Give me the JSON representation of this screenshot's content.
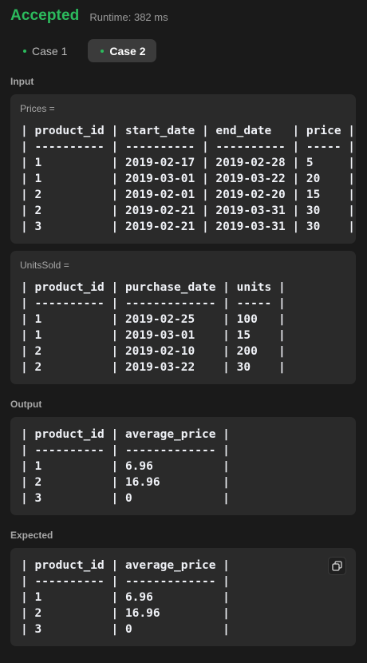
{
  "header": {
    "status": "Accepted",
    "runtime": "Runtime: 382 ms"
  },
  "tabs": [
    {
      "label": "Case 1",
      "active": false
    },
    {
      "label": "Case 2",
      "active": true
    }
  ],
  "input": {
    "label": "Input",
    "prices": {
      "label": "Prices =",
      "table": "| product_id | start_date | end_date   | price |\n| ---------- | ---------- | ---------- | ----- |\n| 1          | 2019-02-17 | 2019-02-28 | 5     |\n| 1          | 2019-03-01 | 2019-03-22 | 20    |\n| 2          | 2019-02-01 | 2019-02-20 | 15    |\n| 2          | 2019-02-21 | 2019-03-31 | 30    |\n| 3          | 2019-02-21 | 2019-03-31 | 30    |"
    },
    "units_sold": {
      "label": "UnitsSold =",
      "table": "| product_id | purchase_date | units |\n| ---------- | ------------- | ----- |\n| 1          | 2019-02-25    | 100   |\n| 1          | 2019-03-01    | 15    |\n| 2          | 2019-02-10    | 200   |\n| 2          | 2019-03-22    | 30    |"
    }
  },
  "output": {
    "label": "Output",
    "table": "| product_id | average_price |\n| ---------- | ------------- |\n| 1          | 6.96          |\n| 2          | 16.96         |\n| 3          | 0             |"
  },
  "expected": {
    "label": "Expected",
    "table": "| product_id | average_price |\n| ---------- | ------------- |\n| 1          | 6.96          |\n| 2          | 16.96         |\n| 3          | 0             |",
    "copy_icon": "copy-icon"
  },
  "colors": {
    "accepted": "#2cbb5d",
    "background": "#1a1a1a",
    "card": "#2a2a2a",
    "tab_active": "#3b3b3b"
  }
}
